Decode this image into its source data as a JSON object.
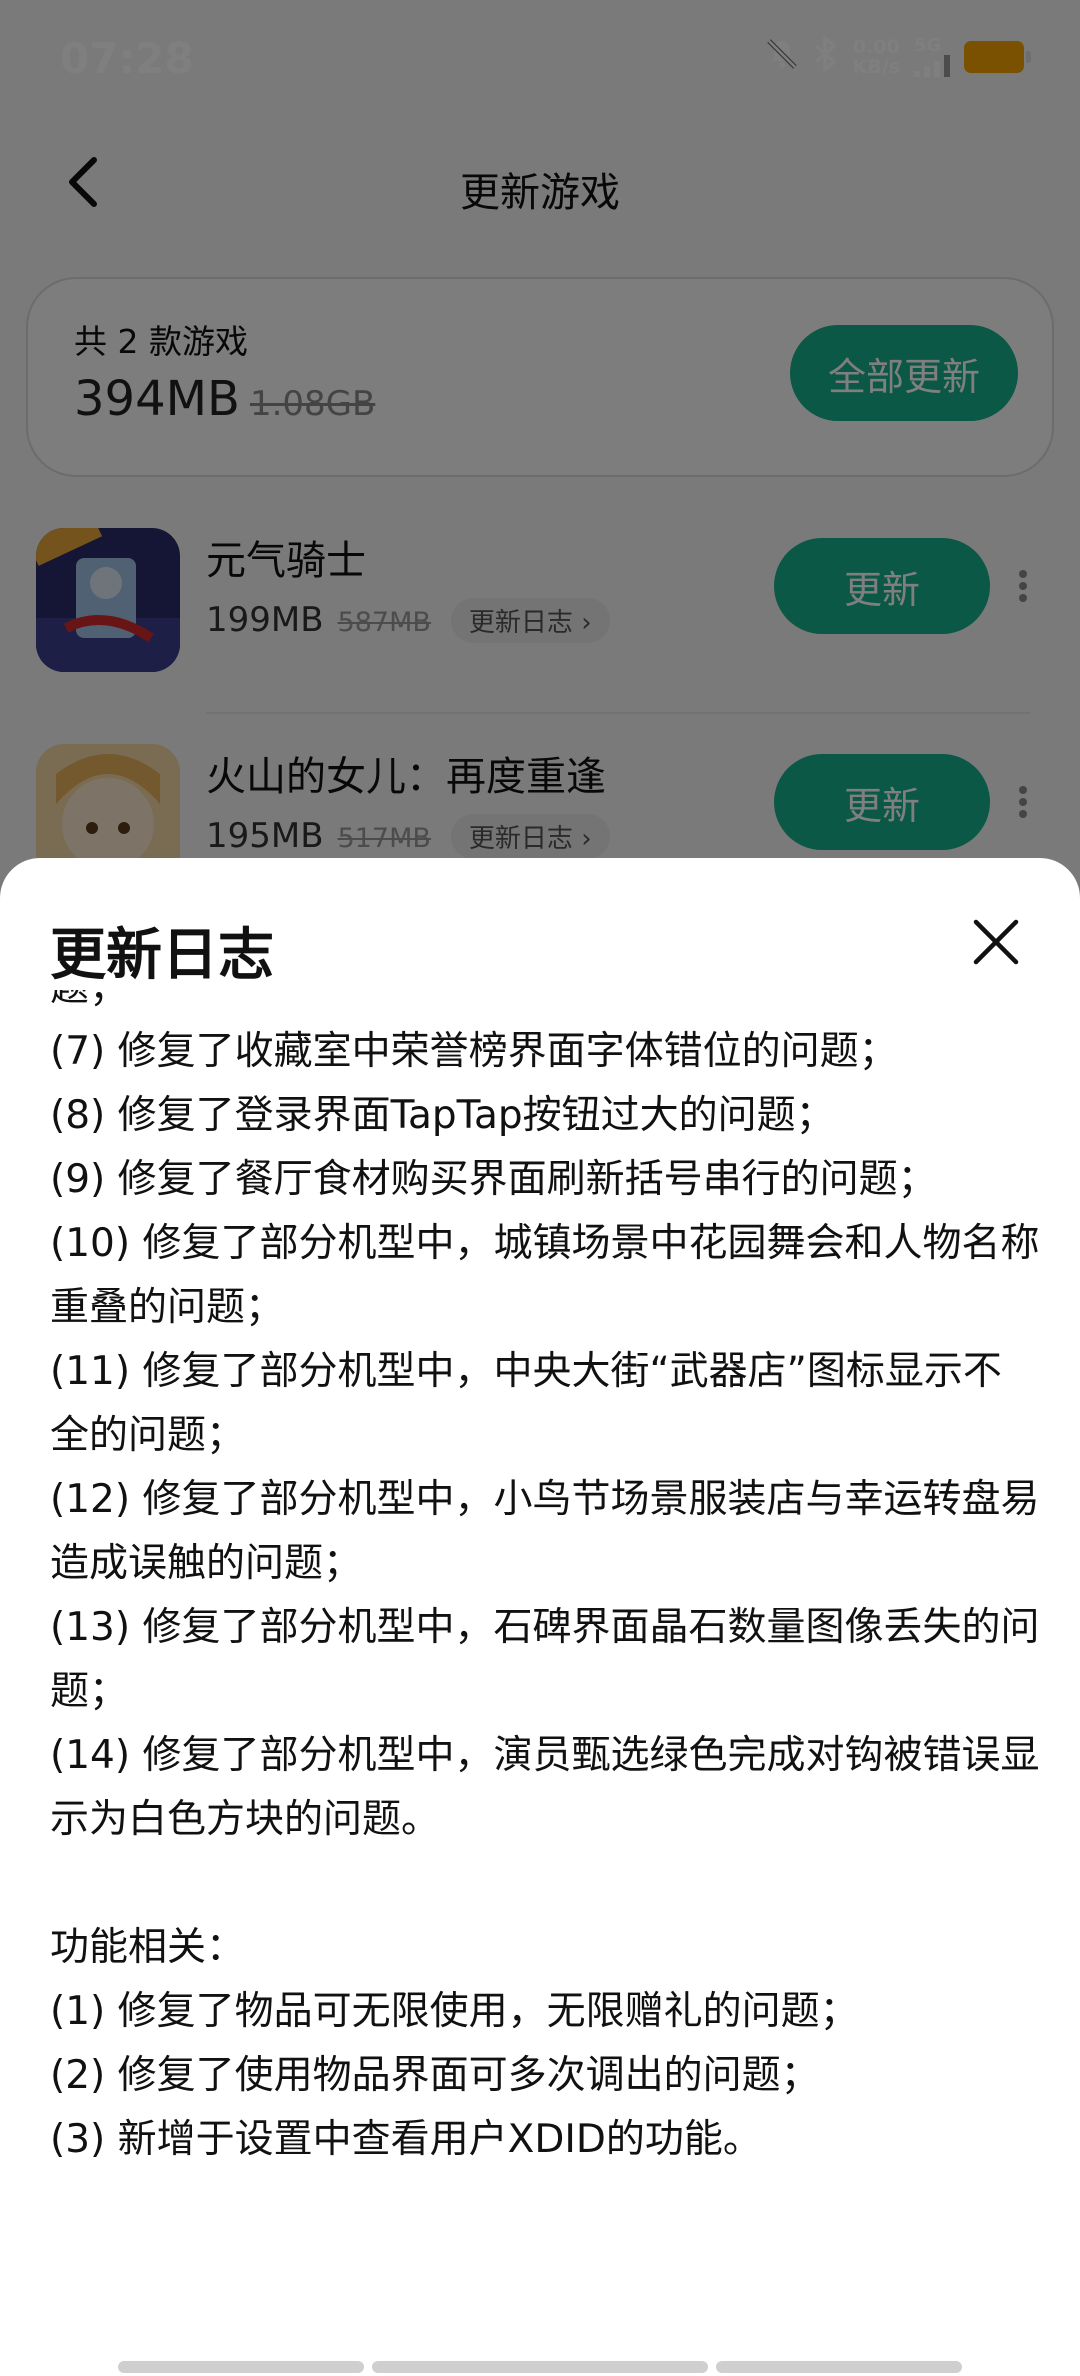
{
  "status_bar": {
    "time": "07:28",
    "net_speed_value": "0.00",
    "net_speed_unit": "KB/s",
    "network": "5G",
    "icons": [
      "bell-off-icon",
      "bluetooth-icon",
      "signal-icon",
      "battery-icon"
    ]
  },
  "header": {
    "title": "更新游戏"
  },
  "summary": {
    "count_text": "共 2 款游戏",
    "size": "394MB",
    "original_size": "1.08GB",
    "update_all_label": "全部更新"
  },
  "games": [
    {
      "name": "元气骑士",
      "size": "199MB",
      "original_size": "587MB",
      "log_label": "更新日志",
      "update_label": "更新"
    },
    {
      "name": "火山的女儿：再度重逢",
      "size": "195MB",
      "original_size": "517MB",
      "log_label": "更新日志",
      "update_label": "更新"
    }
  ],
  "sheet": {
    "title": "更新日志",
    "log_text": "题；\n(7) 修复了收藏室中荣誉榜界面字体错位的问题；\n(8) 修复了登录界面TapTap按钮过大的问题；\n(9) 修复了餐厅食材购买界面刷新括号串行的问题；\n(10) 修复了部分机型中，城镇场景中花园舞会和人物名称重叠的问题；\n(11) 修复了部分机型中，中央大街“武器店”图标显示不全的问题；\n(12) 修复了部分机型中，小鸟节场景服装店与幸运转盘易造成误触的问题；\n(13) 修复了部分机型中，石碑界面晶石数量图像丢失的问题；\n(14) 修复了部分机型中，演员甄选绿色完成对钩被错误显示为白色方块的问题。\n\n功能相关：\n(1) 修复了物品可无限使用，无限赠礼的问题；\n(2) 修复了使用物品界面可多次调出的问题；\n(3) 新增于设置中查看用户XDID的功能。"
  },
  "colors": {
    "accent": "#14b08a",
    "battery": "#f4a300",
    "scrim": "rgba(0,0,0,0.5)"
  }
}
